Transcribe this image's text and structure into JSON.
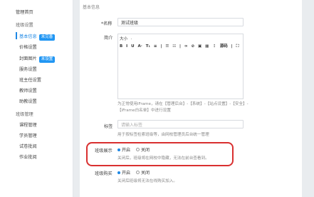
{
  "sidebar": {
    "top_item": "管理首页",
    "group1": "班级设置",
    "items": [
      {
        "label": "基本信息",
        "badge": "未完善",
        "active": true
      },
      {
        "label": "价格设置"
      },
      {
        "label": "封面图片",
        "badge": "未设置"
      },
      {
        "label": "服务设置"
      },
      {
        "label": "班主任设置"
      },
      {
        "label": "教师设置"
      },
      {
        "label": "助教设置"
      }
    ],
    "group2": "班级管理",
    "items2": [
      {
        "label": "课程管理"
      },
      {
        "label": "学员管理"
      },
      {
        "label": "试卷批阅"
      },
      {
        "label": "作业批阅"
      }
    ]
  },
  "header": {
    "section": "基本信息"
  },
  "form": {
    "name_label": "*名称",
    "name_value": "测试班级",
    "intro_label": "简介",
    "toolbar_row1": [
      "大小",
      "·"
    ],
    "toolbar_row2": [
      "B",
      "I",
      "U",
      "A·",
      "T₁",
      "≡",
      "|",
      "☰",
      "☷",
      "|",
      "∞",
      "⊘",
      "▣",
      "▦",
      "⋮",
      "源码",
      "|",
      "⛶"
    ],
    "intro_help": "为正常使用iFrame，请在【管理后台】-【系统】-【站点设置】-【安全】-【iFrame白名单】中进行设置",
    "tags_label": "标签",
    "tags_placeholder": "请输入标签",
    "tags_help": "用于按标签检索班级等，由网校管理员后台统一管理",
    "show_label": "班级展示",
    "show_on": "开启",
    "show_off": "关闭",
    "show_help": "关闭后，班级将在网校中隐藏，无法在前台查看到。",
    "buy_label": "班级购买",
    "buy_on": "开启",
    "buy_off": "关闭",
    "buy_help": "关闭后班级将无法在线购买加入。"
  },
  "colors": {
    "accent": "#1e88e5",
    "highlight": "#d93030"
  }
}
